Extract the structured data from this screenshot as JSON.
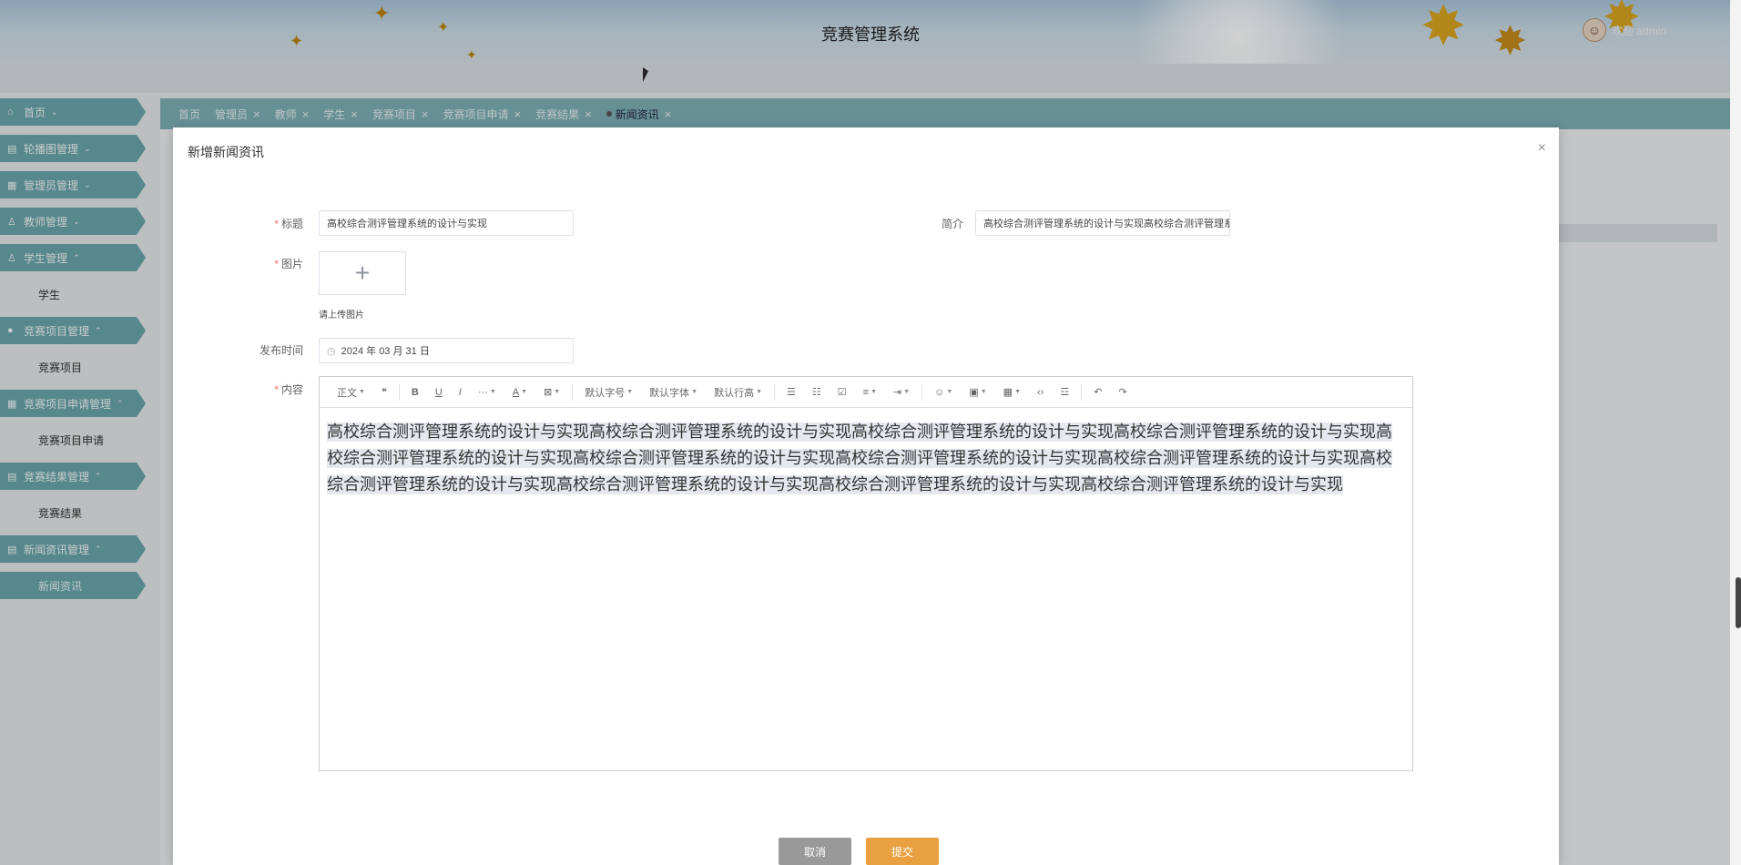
{
  "header": {
    "title": "竞赛管理系统",
    "welcome": "欢迎 admin"
  },
  "sidebar": {
    "items": [
      {
        "icon": "⌂",
        "label": "首页"
      },
      {
        "icon": "▤",
        "label": "轮播图管理"
      },
      {
        "icon": "▦",
        "label": "管理员管理"
      },
      {
        "icon": "♙",
        "label": "教师管理"
      },
      {
        "icon": "♙",
        "label": "学生管理",
        "sub": "学生"
      },
      {
        "icon": "●",
        "label": "竞赛项目管理",
        "sub": "竞赛项目"
      },
      {
        "icon": "▦",
        "label": "竞赛项目申请管理",
        "sub": "竞赛项目申请"
      },
      {
        "icon": "▤",
        "label": "竞赛结果管理",
        "sub": "竞赛结果"
      },
      {
        "icon": "▤",
        "label": "新闻资讯管理",
        "sub": "新闻资讯"
      }
    ]
  },
  "tabs": [
    {
      "label": "首页",
      "closable": false
    },
    {
      "label": "管理员",
      "closable": true
    },
    {
      "label": "教师",
      "closable": true
    },
    {
      "label": "学生",
      "closable": true
    },
    {
      "label": "竞赛项目",
      "closable": true
    },
    {
      "label": "竞赛项目申请",
      "closable": true
    },
    {
      "label": "竞赛结果",
      "closable": true
    },
    {
      "label": "新闻资讯",
      "closable": true,
      "active": true
    }
  ],
  "dialog": {
    "title": "新增新闻资讯",
    "close_icon": "×",
    "labels": {
      "title": "标题",
      "intro": "简介",
      "image": "图片",
      "date": "发布时间",
      "content": "内容"
    },
    "title_value": "高校综合测评管理系统的设计与实现",
    "intro_value": "高校综合测评管理系统的设计与实现高校综合测评管理系统的设计与实现",
    "upload_plus": "+",
    "upload_tip": "请上传图片",
    "date_value": "2024 年 03 月 31 日",
    "content_text": "高校综合测评管理系统的设计与实现高校综合测评管理系统的设计与实现高校综合测评管理系统的设计与实现高校综合测评管理系统的设计与实现高校综合测评管理系统的设计与实现高校综合测评管理系统的设计与实现高校综合测评管理系统的设计与实现高校综合测评管理系统的设计与实现高校综合测评管理系统的设计与实现高校综合测评管理系统的设计与实现高校综合测评管理系统的设计与实现高校综合测评管理系统的设计与实现",
    "toolbar": {
      "paragraph": "正文",
      "font_size": "默认字号",
      "font_family": "默认字体",
      "line_height": "默认行高"
    },
    "cancel_label": "取消",
    "submit_label": "提交"
  }
}
